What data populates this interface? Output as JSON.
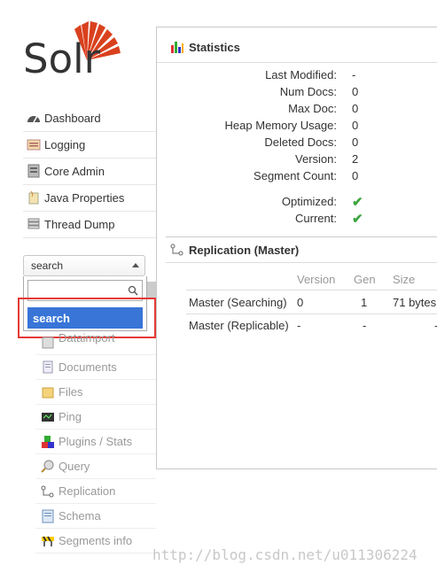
{
  "logo": {
    "text": "Solr"
  },
  "nav": [
    {
      "label": "Dashboard",
      "icon": "dashboard-icon"
    },
    {
      "label": "Logging",
      "icon": "logging-icon"
    },
    {
      "label": "Core Admin",
      "icon": "core-admin-icon"
    },
    {
      "label": "Java Properties",
      "icon": "java-properties-icon"
    },
    {
      "label": "Thread Dump",
      "icon": "thread-dump-icon"
    }
  ],
  "core_selector": {
    "selected": "search",
    "search_value": "",
    "option": "search"
  },
  "core_menu": [
    {
      "label": "Dataimport",
      "icon": "dataimport-icon"
    },
    {
      "label": "Documents",
      "icon": "documents-icon"
    },
    {
      "label": "Files",
      "icon": "files-icon"
    },
    {
      "label": "Ping",
      "icon": "ping-icon"
    },
    {
      "label": "Plugins / Stats",
      "icon": "plugins-icon"
    },
    {
      "label": "Query",
      "icon": "query-icon"
    },
    {
      "label": "Replication",
      "icon": "replication-icon"
    },
    {
      "label": "Schema",
      "icon": "schema-icon"
    },
    {
      "label": "Segments info",
      "icon": "segments-icon"
    }
  ],
  "statistics": {
    "title": "Statistics",
    "rows": [
      {
        "label": "Last Modified:",
        "value": "-"
      },
      {
        "label": "Num Docs:",
        "value": "0"
      },
      {
        "label": "Max Doc:",
        "value": "0"
      },
      {
        "label": "Heap Memory Usage:",
        "value": "0"
      },
      {
        "label": "Deleted Docs:",
        "value": "0"
      },
      {
        "label": "Version:",
        "value": "2"
      },
      {
        "label": "Segment Count:",
        "value": "0"
      }
    ],
    "optimized_label": "Optimized:",
    "current_label": "Current:",
    "check_symbol": "✔"
  },
  "replication": {
    "title": "Replication (Master)",
    "headers": [
      "Version",
      "Gen",
      "Size"
    ],
    "rows": [
      {
        "name": "Master (Searching)",
        "version": "0",
        "gen": "1",
        "size": "71 bytes"
      },
      {
        "name": "Master (Replicable)",
        "version": "-",
        "gen": "-",
        "size": "-"
      }
    ]
  },
  "watermark": "http://blog.csdn.net/u011306224",
  "colors": {
    "accent": "#3875d7",
    "highlight": "#e53935",
    "check": "#3da53d",
    "logo": "#d9411e"
  }
}
